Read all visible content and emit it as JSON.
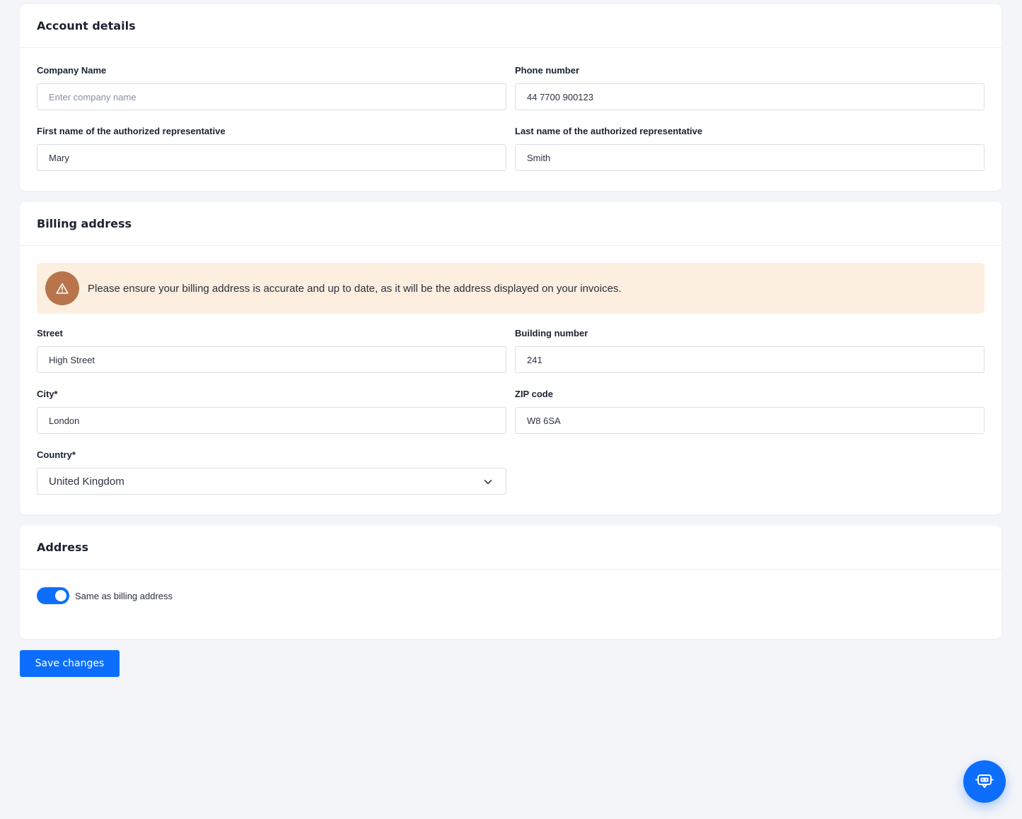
{
  "account": {
    "title": "Account details",
    "company_label": "Company Name",
    "company_value": "",
    "company_placeholder": "Enter company name",
    "phone_label": "Phone number",
    "phone_value": "44 7700 900123",
    "first_name_label": "First name of the authorized representative",
    "first_name_value": "Mary",
    "last_name_label": "Last name of the authorized representative",
    "last_name_value": "Smith"
  },
  "billing": {
    "title": "Billing address",
    "alert_text": "Please ensure your billing address is accurate and up to date, as it will be the address displayed on your invoices.",
    "street_label": "Street",
    "street_value": "High Street",
    "building_label": "Building number",
    "building_value": "241",
    "city_label": "City*",
    "city_value": "London",
    "zip_label": "ZIP code",
    "zip_value": "W8 6SA",
    "country_label": "Country*",
    "country_value": "United Kingdom"
  },
  "address": {
    "title": "Address",
    "same_as_billing_label": "Same as billing address",
    "same_as_billing": true
  },
  "actions": {
    "save_label": "Save changes"
  },
  "colors": {
    "accent": "#0d6efd",
    "alert_bg": "#fdefe0",
    "alert_icon_bg": "#b8744a",
    "page_bg": "#f4f5f9"
  },
  "icons": {
    "alert": "warning-triangle-icon",
    "select": "chevron-down-icon",
    "chatbot": "chatbot-icon"
  }
}
